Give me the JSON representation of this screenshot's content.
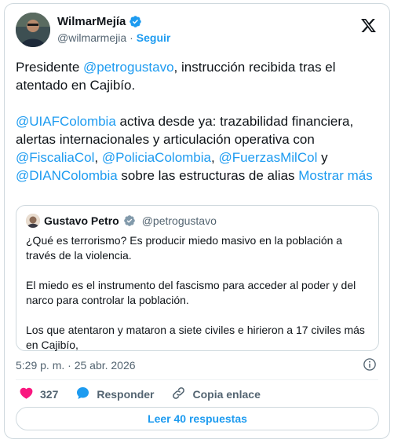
{
  "author": {
    "name": "WilmarMejía",
    "handle": "@wilmarmejia",
    "separator": "·",
    "follow_label": "Seguir"
  },
  "tweet": {
    "p1_before": "Presidente ",
    "p1_mention": "@petrogustavo",
    "p1_after": ", instrucción recibida tras el atentado en Cajibío.",
    "p2_m1": "@UIAFColombia",
    "p2_t1": " activa desde ya: trazabilidad financiera, alertas internacionales y articulación operativa con ",
    "p2_m2": "@FiscaliaCol",
    "p2_t2": ", ",
    "p2_m3": "@PoliciaColombia",
    "p2_t3": ", ",
    "p2_m4": "@FuerzasMilCol",
    "p2_t4": " y ",
    "p2_m5": "@DIANColombia",
    "p2_t5": " sobre las estructuras de alias ",
    "show_more": "Mostrar más"
  },
  "quote": {
    "name": "Gustavo Petro",
    "handle": "@petrogustavo",
    "p1": "¿Qué es terrorismo? Es producir miedo masivo en la población a través de la violencia.",
    "p2": "El miedo es el instrumento del fascismo para acceder al poder y del narco para controlar la población.",
    "p3": "Los que atentaron y mataron a siete civiles e hirieron a 17 civiles más en Cajibío,"
  },
  "meta": {
    "timestamp": "5:29 p. m. · 25 abr. 2026"
  },
  "actions": {
    "likes": "327",
    "reply_label": "Responder",
    "copy_label": "Copia enlace"
  },
  "read_replies_label": "Leer 40 respuestas",
  "colors": {
    "accent": "#1d9bf0",
    "like": "#f91880",
    "text": "#0f1419",
    "muted": "#536471",
    "border": "#cfd9de"
  },
  "icons": {
    "verified": "verified-badge-icon",
    "x_logo": "x-logo-icon",
    "info": "info-icon",
    "like": "heart-icon",
    "reply": "speech-bubble-icon",
    "copy": "link-icon"
  }
}
